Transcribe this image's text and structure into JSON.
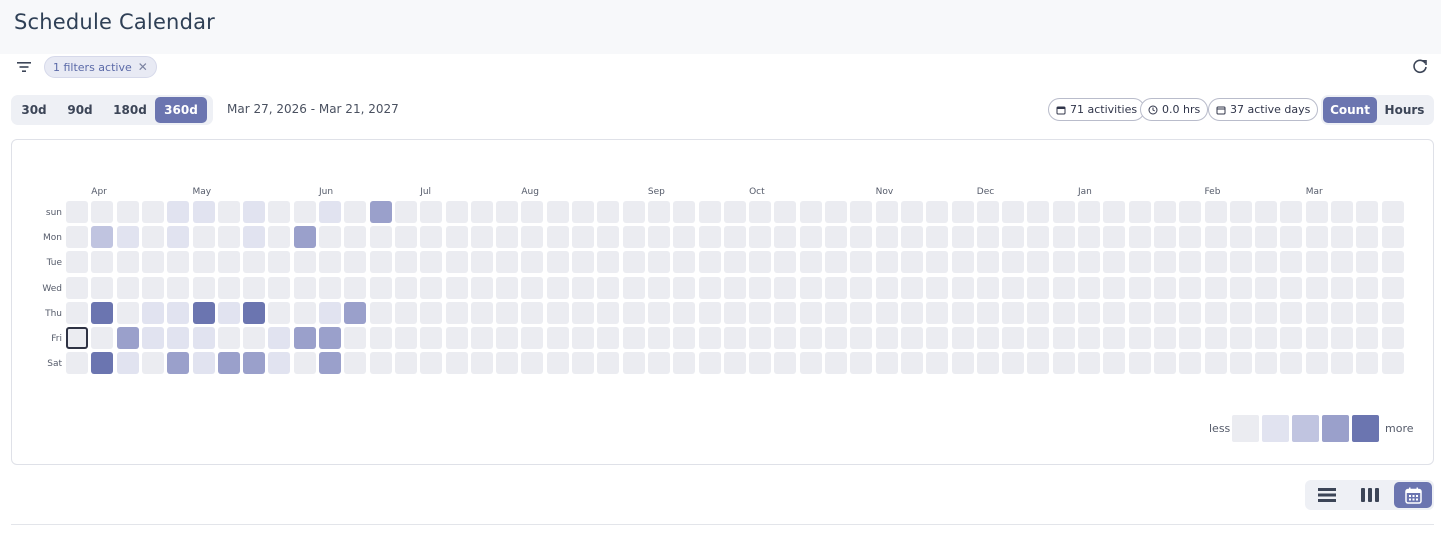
{
  "page": {
    "title": "Schedule Calendar"
  },
  "filters": {
    "chip_label": "1 filters active"
  },
  "range_buttons": [
    {
      "label": "30d",
      "active": false
    },
    {
      "label": "90d",
      "active": false
    },
    {
      "label": "180d",
      "active": false
    },
    {
      "label": "360d",
      "active": true
    }
  ],
  "date_range": "Mar 27, 2026 - Mar 21, 2027",
  "stats": {
    "activities": "71 activities",
    "hours": "0.0 hrs",
    "active_days": "37 active days"
  },
  "metric_toggle": [
    {
      "label": "Count",
      "active": true
    },
    {
      "label": "Hours",
      "active": false
    }
  ],
  "heatmap": {
    "weeks": 53,
    "months": [
      {
        "label": "Apr",
        "week": 1
      },
      {
        "label": "May",
        "week": 5
      },
      {
        "label": "Jun",
        "week": 10
      },
      {
        "label": "Jul",
        "week": 14
      },
      {
        "label": "Aug",
        "week": 18
      },
      {
        "label": "Sep",
        "week": 23
      },
      {
        "label": "Oct",
        "week": 27
      },
      {
        "label": "Nov",
        "week": 32
      },
      {
        "label": "Dec",
        "week": 36
      },
      {
        "label": "Jan",
        "week": 40
      },
      {
        "label": "Feb",
        "week": 45
      },
      {
        "label": "Mar",
        "week": 49
      }
    ],
    "weekdays": [
      "sun",
      "Mon",
      "Tue",
      "Wed",
      "Thu",
      "Fri",
      "Sat"
    ],
    "levels": [
      [
        0,
        0,
        0,
        0,
        1,
        1,
        0,
        1,
        0,
        0,
        1,
        0,
        3
      ],
      [
        0,
        2,
        1,
        0,
        1,
        0,
        0,
        1,
        0,
        3,
        0,
        0,
        0
      ],
      [
        0,
        0,
        0,
        0,
        0,
        0,
        0,
        0,
        0,
        0,
        0,
        0,
        0
      ],
      [
        0,
        0,
        0,
        0,
        0,
        0,
        0,
        0,
        0,
        0,
        0,
        0,
        0
      ],
      [
        0,
        4,
        0,
        1,
        1,
        4,
        1,
        4,
        0,
        0,
        1,
        3,
        0
      ],
      [
        0,
        0,
        3,
        1,
        1,
        1,
        0,
        0,
        1,
        3,
        3,
        0,
        0
      ],
      [
        0,
        4,
        1,
        0,
        3,
        1,
        3,
        3,
        1,
        0,
        3,
        0,
        0
      ]
    ],
    "today": {
      "day": 5,
      "week": 0
    },
    "colors": [
      "#ebecf1",
      "#e1e3f0",
      "#c0c4e0",
      "#9aa0cb",
      "#6b75b0"
    ],
    "legend": {
      "less": "less",
      "more": "more"
    }
  },
  "view_buttons": [
    {
      "name": "list-view-icon",
      "active": false
    },
    {
      "name": "columns-view-icon",
      "active": false
    },
    {
      "name": "calendar-view-icon",
      "active": true
    }
  ]
}
